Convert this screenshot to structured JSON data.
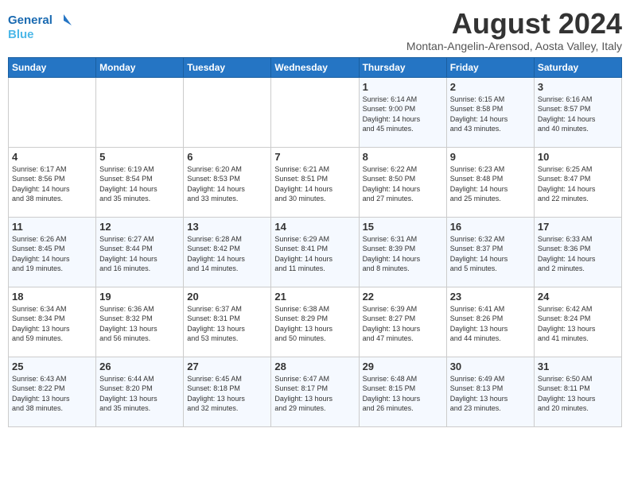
{
  "logo": {
    "line1": "General",
    "line2": "Blue"
  },
  "title": "August 2024",
  "subtitle": "Montan-Angelin-Arensod, Aosta Valley, Italy",
  "days_of_week": [
    "Sunday",
    "Monday",
    "Tuesday",
    "Wednesday",
    "Thursday",
    "Friday",
    "Saturday"
  ],
  "weeks": [
    [
      {
        "day": "",
        "info": ""
      },
      {
        "day": "",
        "info": ""
      },
      {
        "day": "",
        "info": ""
      },
      {
        "day": "",
        "info": ""
      },
      {
        "day": "1",
        "info": "Sunrise: 6:14 AM\nSunset: 9:00 PM\nDaylight: 14 hours\nand 45 minutes."
      },
      {
        "day": "2",
        "info": "Sunrise: 6:15 AM\nSunset: 8:58 PM\nDaylight: 14 hours\nand 43 minutes."
      },
      {
        "day": "3",
        "info": "Sunrise: 6:16 AM\nSunset: 8:57 PM\nDaylight: 14 hours\nand 40 minutes."
      }
    ],
    [
      {
        "day": "4",
        "info": "Sunrise: 6:17 AM\nSunset: 8:56 PM\nDaylight: 14 hours\nand 38 minutes."
      },
      {
        "day": "5",
        "info": "Sunrise: 6:19 AM\nSunset: 8:54 PM\nDaylight: 14 hours\nand 35 minutes."
      },
      {
        "day": "6",
        "info": "Sunrise: 6:20 AM\nSunset: 8:53 PM\nDaylight: 14 hours\nand 33 minutes."
      },
      {
        "day": "7",
        "info": "Sunrise: 6:21 AM\nSunset: 8:51 PM\nDaylight: 14 hours\nand 30 minutes."
      },
      {
        "day": "8",
        "info": "Sunrise: 6:22 AM\nSunset: 8:50 PM\nDaylight: 14 hours\nand 27 minutes."
      },
      {
        "day": "9",
        "info": "Sunrise: 6:23 AM\nSunset: 8:48 PM\nDaylight: 14 hours\nand 25 minutes."
      },
      {
        "day": "10",
        "info": "Sunrise: 6:25 AM\nSunset: 8:47 PM\nDaylight: 14 hours\nand 22 minutes."
      }
    ],
    [
      {
        "day": "11",
        "info": "Sunrise: 6:26 AM\nSunset: 8:45 PM\nDaylight: 14 hours\nand 19 minutes."
      },
      {
        "day": "12",
        "info": "Sunrise: 6:27 AM\nSunset: 8:44 PM\nDaylight: 14 hours\nand 16 minutes."
      },
      {
        "day": "13",
        "info": "Sunrise: 6:28 AM\nSunset: 8:42 PM\nDaylight: 14 hours\nand 14 minutes."
      },
      {
        "day": "14",
        "info": "Sunrise: 6:29 AM\nSunset: 8:41 PM\nDaylight: 14 hours\nand 11 minutes."
      },
      {
        "day": "15",
        "info": "Sunrise: 6:31 AM\nSunset: 8:39 PM\nDaylight: 14 hours\nand 8 minutes."
      },
      {
        "day": "16",
        "info": "Sunrise: 6:32 AM\nSunset: 8:37 PM\nDaylight: 14 hours\nand 5 minutes."
      },
      {
        "day": "17",
        "info": "Sunrise: 6:33 AM\nSunset: 8:36 PM\nDaylight: 14 hours\nand 2 minutes."
      }
    ],
    [
      {
        "day": "18",
        "info": "Sunrise: 6:34 AM\nSunset: 8:34 PM\nDaylight: 13 hours\nand 59 minutes."
      },
      {
        "day": "19",
        "info": "Sunrise: 6:36 AM\nSunset: 8:32 PM\nDaylight: 13 hours\nand 56 minutes."
      },
      {
        "day": "20",
        "info": "Sunrise: 6:37 AM\nSunset: 8:31 PM\nDaylight: 13 hours\nand 53 minutes."
      },
      {
        "day": "21",
        "info": "Sunrise: 6:38 AM\nSunset: 8:29 PM\nDaylight: 13 hours\nand 50 minutes."
      },
      {
        "day": "22",
        "info": "Sunrise: 6:39 AM\nSunset: 8:27 PM\nDaylight: 13 hours\nand 47 minutes."
      },
      {
        "day": "23",
        "info": "Sunrise: 6:41 AM\nSunset: 8:26 PM\nDaylight: 13 hours\nand 44 minutes."
      },
      {
        "day": "24",
        "info": "Sunrise: 6:42 AM\nSunset: 8:24 PM\nDaylight: 13 hours\nand 41 minutes."
      }
    ],
    [
      {
        "day": "25",
        "info": "Sunrise: 6:43 AM\nSunset: 8:22 PM\nDaylight: 13 hours\nand 38 minutes."
      },
      {
        "day": "26",
        "info": "Sunrise: 6:44 AM\nSunset: 8:20 PM\nDaylight: 13 hours\nand 35 minutes."
      },
      {
        "day": "27",
        "info": "Sunrise: 6:45 AM\nSunset: 8:18 PM\nDaylight: 13 hours\nand 32 minutes."
      },
      {
        "day": "28",
        "info": "Sunrise: 6:47 AM\nSunset: 8:17 PM\nDaylight: 13 hours\nand 29 minutes."
      },
      {
        "day": "29",
        "info": "Sunrise: 6:48 AM\nSunset: 8:15 PM\nDaylight: 13 hours\nand 26 minutes."
      },
      {
        "day": "30",
        "info": "Sunrise: 6:49 AM\nSunset: 8:13 PM\nDaylight: 13 hours\nand 23 minutes."
      },
      {
        "day": "31",
        "info": "Sunrise: 6:50 AM\nSunset: 8:11 PM\nDaylight: 13 hours\nand 20 minutes."
      }
    ]
  ]
}
